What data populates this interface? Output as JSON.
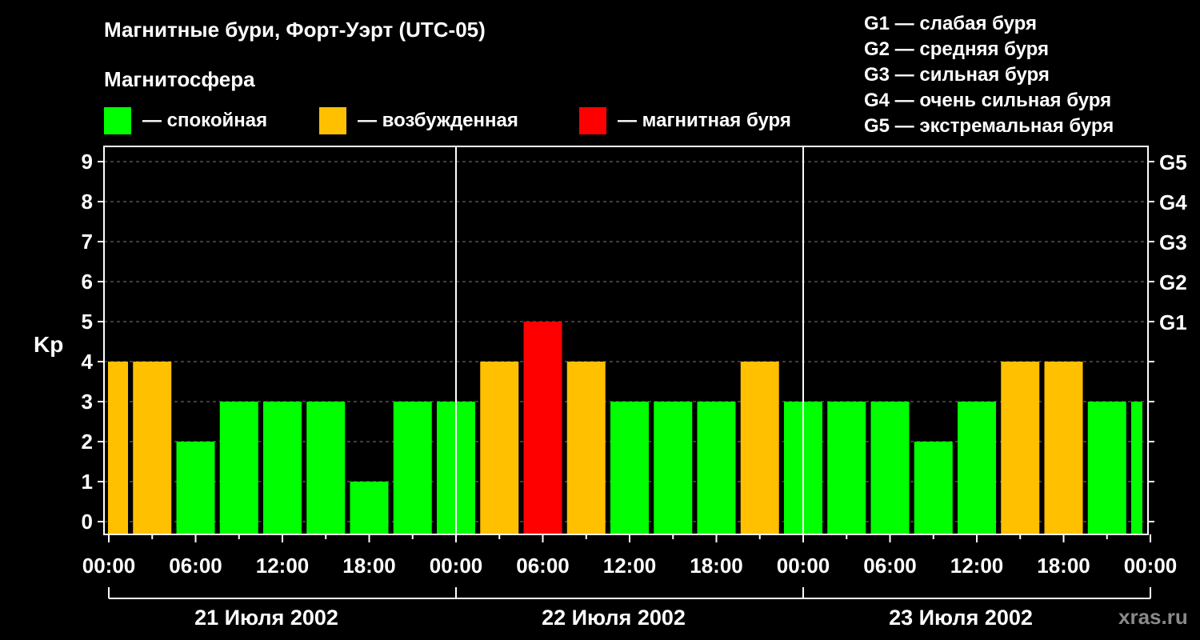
{
  "header": {
    "title": "Магнитные бури, Форт-Уэрт (UTC-05)",
    "subtitle": "Магнитосфера"
  },
  "legend": {
    "quiet": {
      "label": "— спокойная",
      "color": "#00ff00"
    },
    "active": {
      "label": "— возбужденная",
      "color": "#ffc000"
    },
    "storm": {
      "label": "— магнитная буря",
      "color": "#ff0000"
    }
  },
  "g_legend": [
    "G1 — слабая буря",
    "G2 — средняя буря",
    "G3 — сильная буря",
    "G4 — очень сильная буря",
    "G5 — экстремальная буря"
  ],
  "watermark": "xras.ru",
  "chart_data": {
    "type": "bar",
    "ylabel": "Kp",
    "ylim": [
      0,
      9
    ],
    "yticks": [
      "0",
      "1",
      "2",
      "3",
      "4",
      "5",
      "6",
      "7",
      "8",
      "9"
    ],
    "right_axis": [
      {
        "kp": 5,
        "label": "G1"
      },
      {
        "kp": 6,
        "label": "G2"
      },
      {
        "kp": 7,
        "label": "G3"
      },
      {
        "kp": 8,
        "label": "G4"
      },
      {
        "kp": 9,
        "label": "G5"
      }
    ],
    "grid": "horizontal dashed",
    "x_tick_labels": [
      "00:00",
      "06:00",
      "12:00",
      "18:00",
      "00:00",
      "06:00",
      "12:00",
      "18:00",
      "00:00",
      "06:00",
      "12:00",
      "18:00",
      "00:00"
    ],
    "days": [
      "21 Июля 2002",
      "22 Июля 2002",
      "23 Июля 2002"
    ],
    "interval_hours": 3,
    "values": [
      4,
      4,
      2,
      3,
      3,
      3,
      1,
      3,
      3,
      4,
      5,
      4,
      3,
      3,
      3,
      4,
      3,
      3,
      3,
      2,
      3,
      4,
      4,
      3,
      3
    ],
    "levels": [
      "active",
      "active",
      "quiet",
      "quiet",
      "quiet",
      "quiet",
      "quiet",
      "quiet",
      "quiet",
      "active",
      "storm",
      "active",
      "quiet",
      "quiet",
      "quiet",
      "active",
      "quiet",
      "quiet",
      "quiet",
      "quiet",
      "quiet",
      "active",
      "active",
      "quiet",
      "quiet"
    ]
  }
}
